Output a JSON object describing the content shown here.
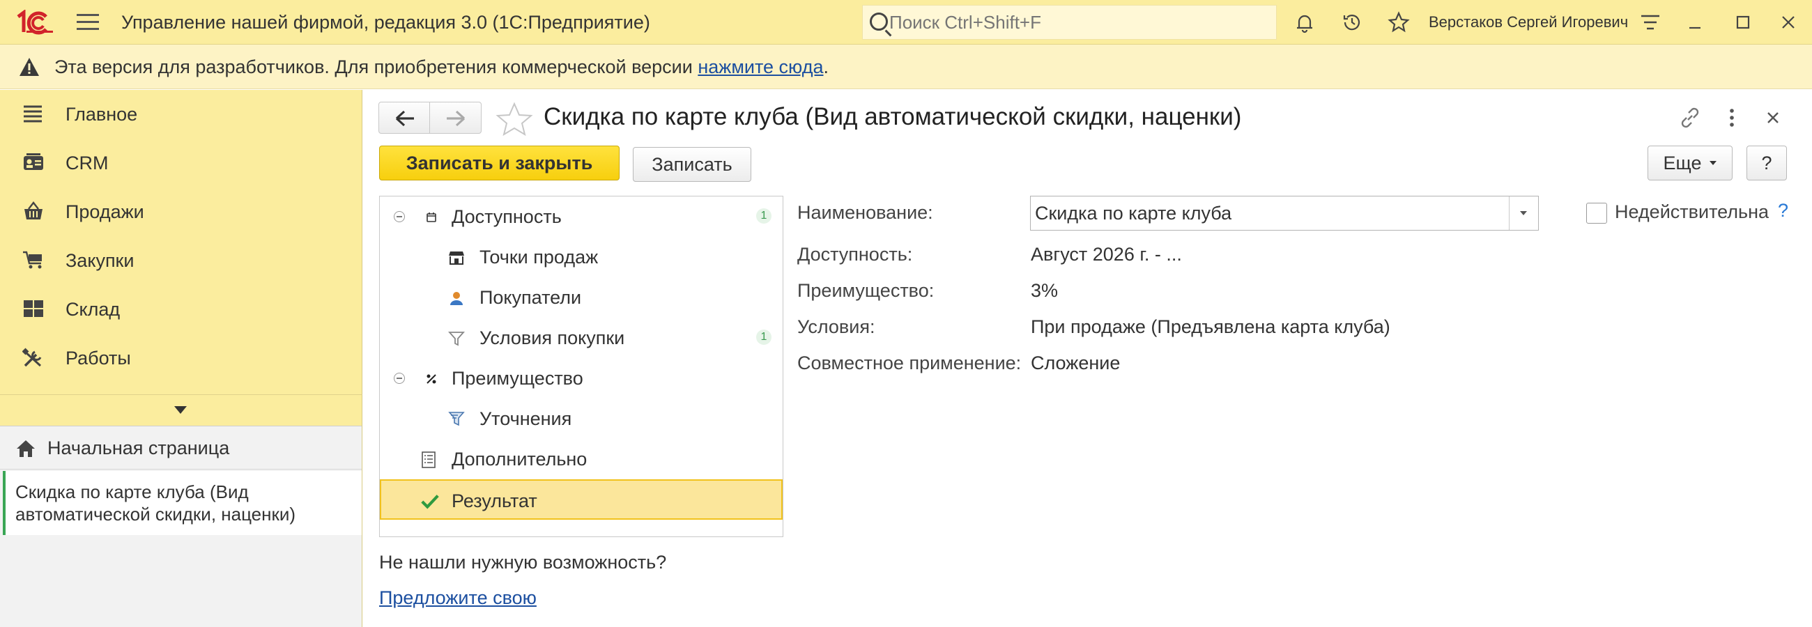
{
  "app": {
    "title": "Управление нашей фирмой, редакция 3.0  (1С:Предприятие)",
    "search_placeholder": "Поиск Ctrl+Shift+F",
    "user": "Верстаков Сергей Игоревич"
  },
  "notice": {
    "text": "Эта версия для разработчиков. Для приобретения коммерческой версии ",
    "link": "нажмите сюда",
    "tail": "."
  },
  "sidebar": {
    "items": [
      {
        "label": "Главное",
        "icon": "menu-lines-icon"
      },
      {
        "label": "CRM",
        "icon": "contact-card-icon"
      },
      {
        "label": "Продажи",
        "icon": "basket-icon"
      },
      {
        "label": "Закупки",
        "icon": "cart-icon"
      },
      {
        "label": "Склад",
        "icon": "warehouse-icon"
      },
      {
        "label": "Работы",
        "icon": "tools-icon"
      }
    ],
    "home": "Начальная страница",
    "open_doc": "Скидка по карте клуба (Вид автоматической скидки, наценки)"
  },
  "form": {
    "title": "Скидка по карте клуба (Вид автоматической скидки, наценки)",
    "save_close": "Записать и закрыть",
    "save": "Записать",
    "more": "Еще",
    "help": "?"
  },
  "tree": [
    {
      "label": "Доступность",
      "count": "1",
      "icon": "calendar-icon"
    },
    {
      "label": "Точки продаж",
      "icon": "store-icon"
    },
    {
      "label": "Покупатели",
      "icon": "person-icon"
    },
    {
      "label": "Условия покупки",
      "count": "1",
      "icon": "filter-icon"
    },
    {
      "label": "Преимущество",
      "icon": "percent-icon"
    },
    {
      "label": "Уточнения",
      "icon": "refine-icon"
    },
    {
      "label": "Дополнительно",
      "icon": "list-icon"
    },
    {
      "label": "Результат",
      "icon": "checkmark-icon"
    }
  ],
  "not_found": "Не нашли нужную возможность?",
  "suggest": "Предложите свою",
  "fields": {
    "name_label": "Наименование:",
    "name_value": "Скидка по карте клуба",
    "inactive_label": "Недействительна",
    "availability_label": "Доступность:",
    "availability_value": "Август 2026 г. - ...",
    "advantage_label": "Преимущество:",
    "advantage_value": "3%",
    "conditions_label": "Условия:",
    "conditions_value": "При продаже (Предъявлена карта клуба)",
    "joint_label": "Совместное применение:",
    "joint_value": "Сложение"
  },
  "colors": {
    "accent_yellow": "#fbed9e",
    "primary_button": "#f7cf0e",
    "link": "#1c4fa0",
    "counter_green": "#3a9a4f"
  }
}
